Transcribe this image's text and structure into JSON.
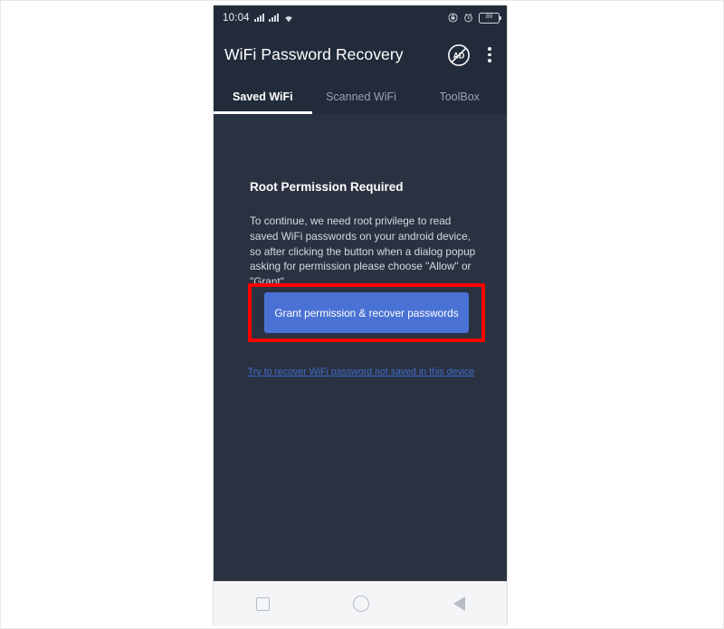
{
  "status_bar": {
    "time": "10:04",
    "left_icons": [
      "signal-bars-icon",
      "signal-bars-icon",
      "wifi-icon"
    ],
    "right_icons": [
      "location-icon",
      "alarm-icon"
    ],
    "battery_level": "89"
  },
  "app_bar": {
    "title": "WiFi Password Recovery",
    "no_ads_label": "AD",
    "icons": [
      "no-ads-icon",
      "overflow-menu-icon"
    ]
  },
  "tabs": [
    {
      "label": "Saved WiFi",
      "active": true
    },
    {
      "label": "Scanned WiFi",
      "active": false
    },
    {
      "label": "ToolBox",
      "active": false
    }
  ],
  "main": {
    "heading": "Root Permission Required",
    "body": "To continue, we need root privilege to read saved WiFi passwords on your android device, so after clicking the button when a dialog popup asking for permission please choose \"Allow\" or \"Grant\".",
    "grant_button_label": "Grant permission & recover passwords",
    "recover_link_label": "Try to recover WiFi password not saved in this device"
  },
  "nav_bar": {
    "recents_label": "recents-square-icon",
    "home_label": "home-circle-icon",
    "back_label": "back-triangle-icon"
  },
  "colors": {
    "app_bar_bg": "#222b3a",
    "content_bg": "#2a3242",
    "button_blue": "#4a72d4",
    "highlight_red": "#ff0000",
    "link_blue": "#3f6bc9",
    "nav_bar_bg": "#f4f5f7"
  }
}
